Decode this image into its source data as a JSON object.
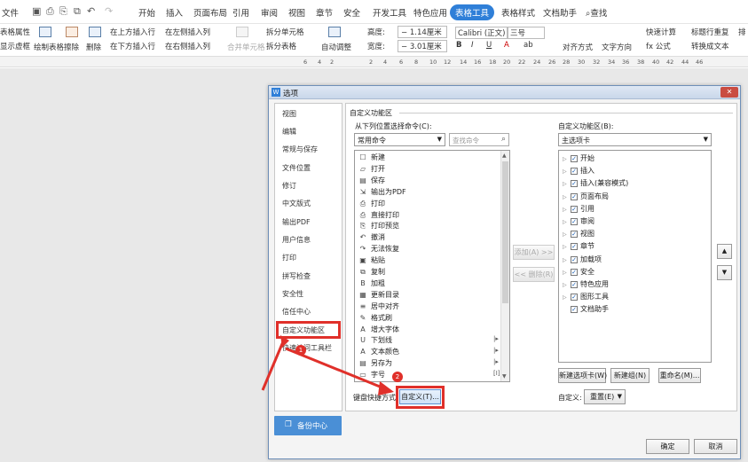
{
  "menubar": {
    "file": "文件",
    "tabs": [
      "开始",
      "插入",
      "页面布局",
      "引用",
      "审阅",
      "视图",
      "章节",
      "安全",
      "开发工具",
      "特色应用",
      "表格工具",
      "表格样式",
      "文档助手"
    ],
    "active_tab": "表格工具",
    "search": "查找"
  },
  "toolbar": {
    "left_top": "表格属性",
    "left_bottom": "显示虚框",
    "draw_table": "绘制表格",
    "erase": "擦除",
    "delete": "删除",
    "insert_above": "在上方插入行",
    "insert_below": "在下方插入行",
    "insert_left": "在左侧插入列",
    "insert_right": "在右侧插入列",
    "merge_cells": "合并单元格",
    "split_cells": "拆分单元格",
    "split_table": "拆分表格",
    "autofit": "自动调整",
    "height_label": "高度:",
    "height_value": "1.14厘米",
    "width_label": "宽度:",
    "width_value": "3.01厘米",
    "font": "Calibri (正文)",
    "font_size": "三号",
    "align": "对齐方式",
    "text_direction": "文字方向",
    "quick_calc": "快速计算",
    "formula": "fx 公式",
    "repeat_header": "标题行重复",
    "convert_text": "转换成文本",
    "extra": "排"
  },
  "ruler": [
    "6",
    "4",
    "2",
    "2",
    "4",
    "6",
    "8",
    "10",
    "12",
    "14",
    "16",
    "18",
    "20",
    "22",
    "24",
    "26",
    "28",
    "30",
    "32",
    "34",
    "36",
    "38",
    "40",
    "42",
    "44",
    "46"
  ],
  "dialog": {
    "title": "选项",
    "logo": "W",
    "nav": [
      "视图",
      "编辑",
      "常规与保存",
      "文件位置",
      "修订",
      "中文版式",
      "输出PDF",
      "用户信息",
      "打印",
      "拼写检查",
      "安全性",
      "信任中心",
      "自定义功能区",
      "快速访问工具栏"
    ],
    "backup": "备份中心",
    "section_title": "自定义功能区",
    "choose_from_label": "从下列位置选择命令(C):",
    "choose_from_value": "常用命令",
    "search_placeholder": "查找命令",
    "commands": [
      {
        "icon": "☐",
        "label": "新建"
      },
      {
        "icon": "▱",
        "label": "打开"
      },
      {
        "icon": "▤",
        "label": "保存"
      },
      {
        "icon": "⇲",
        "label": "输出为PDF"
      },
      {
        "icon": "⎙",
        "label": "打印"
      },
      {
        "icon": "⎙",
        "label": "直接打印"
      },
      {
        "icon": "⎘",
        "label": "打印预览"
      },
      {
        "icon": "↶",
        "label": "撤消"
      },
      {
        "icon": "↷",
        "label": "无法恢复"
      },
      {
        "icon": "▣",
        "label": "粘贴"
      },
      {
        "icon": "⧉",
        "label": "复制"
      },
      {
        "icon": "B",
        "label": "加粗"
      },
      {
        "icon": "▦",
        "label": "更新目录"
      },
      {
        "icon": "≡",
        "label": "居中对齐"
      },
      {
        "icon": "✎",
        "label": "格式刷"
      },
      {
        "icon": "A",
        "label": "增大字体"
      },
      {
        "icon": "U",
        "label": "下划线",
        "sub": "|▸"
      },
      {
        "icon": "A",
        "label": "文本颜色",
        "sub": "|▸"
      },
      {
        "icon": "▤",
        "label": "另存为",
        "sub": "|▸"
      },
      {
        "icon": "▭",
        "label": "字号",
        "sub": "[I]"
      }
    ],
    "add_button": "添加(A) >>",
    "remove_button": "<< 删除(R)",
    "customize_label": "自定义功能区(B):",
    "customize_value": "主选项卡",
    "tabs_tree": [
      "开始",
      "插入",
      "插入(兼容模式)",
      "页面布局",
      "引用",
      "审阅",
      "视图",
      "章节",
      "加载项",
      "安全",
      "特色应用",
      "图形工具",
      "文档助手"
    ],
    "new_tab": "新建选项卡(W)",
    "new_group": "新建组(N)",
    "rename": "重命名(M)...",
    "shortcut_label": "键盘快捷方式:",
    "customize_button": "自定义(T)...",
    "custom_label": "自定义:",
    "reset": "重置(E)",
    "ok": "确定",
    "cancel": "取消",
    "badge1": "1",
    "badge2": "2"
  },
  "colors": {
    "accent": "#2f7fd8",
    "highlight": "#e0302a"
  }
}
